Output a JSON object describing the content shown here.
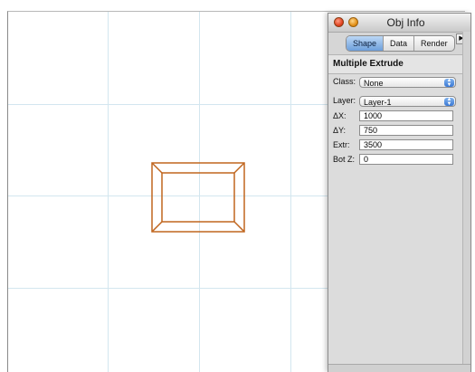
{
  "palette": {
    "title": "Obj Info",
    "tabs": [
      "Shape",
      "Data",
      "Render"
    ],
    "active_tab": "Shape",
    "menu_arrow": "▶",
    "object_type": "Multiple Extrude",
    "class_label": "Class:",
    "class_value": "None",
    "layer_label": "Layer:",
    "layer_value": "Layer-1",
    "fields": [
      {
        "label": "ΔX:",
        "value": "1000"
      },
      {
        "label": "ΔY:",
        "value": "750"
      },
      {
        "label": "Extr:",
        "value": "3500"
      },
      {
        "label": "Bot Z:",
        "value": "0"
      }
    ]
  },
  "colors": {
    "shape_stroke": "#c0661f",
    "grid": "#d3e6ef",
    "tab_active": "#6d9fdb"
  },
  "icons": {
    "close": "close-icon",
    "minimize": "minimize-icon",
    "popup": "popup-arrows-icon",
    "flyout": "triangle-right-icon"
  }
}
